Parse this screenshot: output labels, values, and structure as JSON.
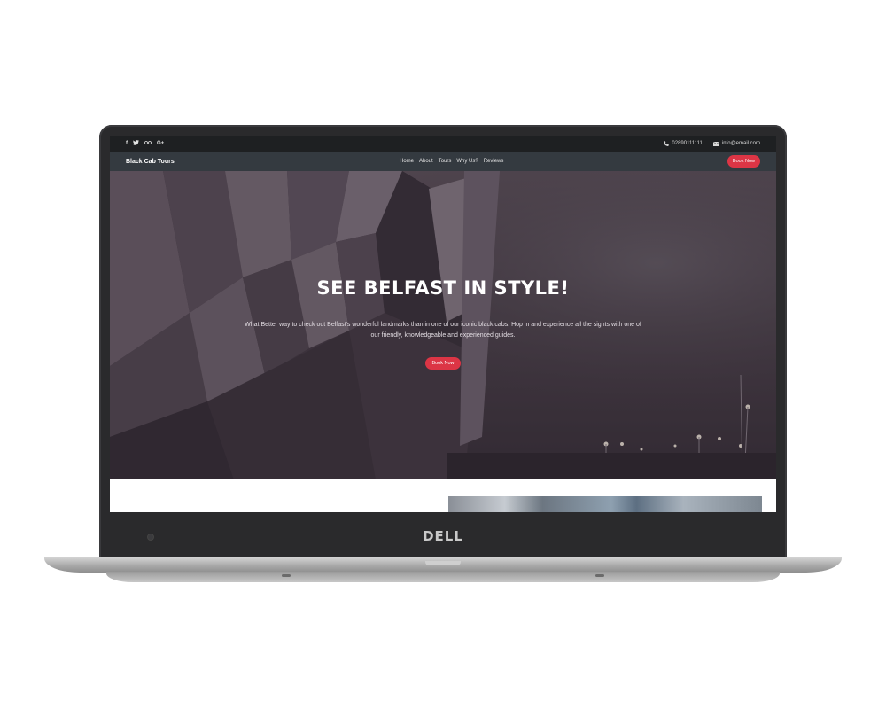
{
  "device": {
    "brand_logo": "DELL"
  },
  "topbar": {
    "social": [
      "f",
      "t",
      "tripadvisor",
      "G+"
    ],
    "phone": "02890111111",
    "email": "info@email.com",
    "phone_icon": "phone-icon",
    "email_icon": "envelope-icon"
  },
  "navbar": {
    "brand": "Black Cab Tours",
    "links": [
      "Home",
      "About",
      "Tours",
      "Why Us?",
      "Reviews"
    ],
    "cta": "Book Now"
  },
  "hero": {
    "title": "SEE BELFAST IN STYLE!",
    "text": "What Better way to check out Belfast's wonderful landmarks than in one of our iconic black cabs. Hop in and experience all the sights with one of our friendly, knowledgeable and experienced guides.",
    "button": "Book Now",
    "accent_color": "#dc3545"
  }
}
